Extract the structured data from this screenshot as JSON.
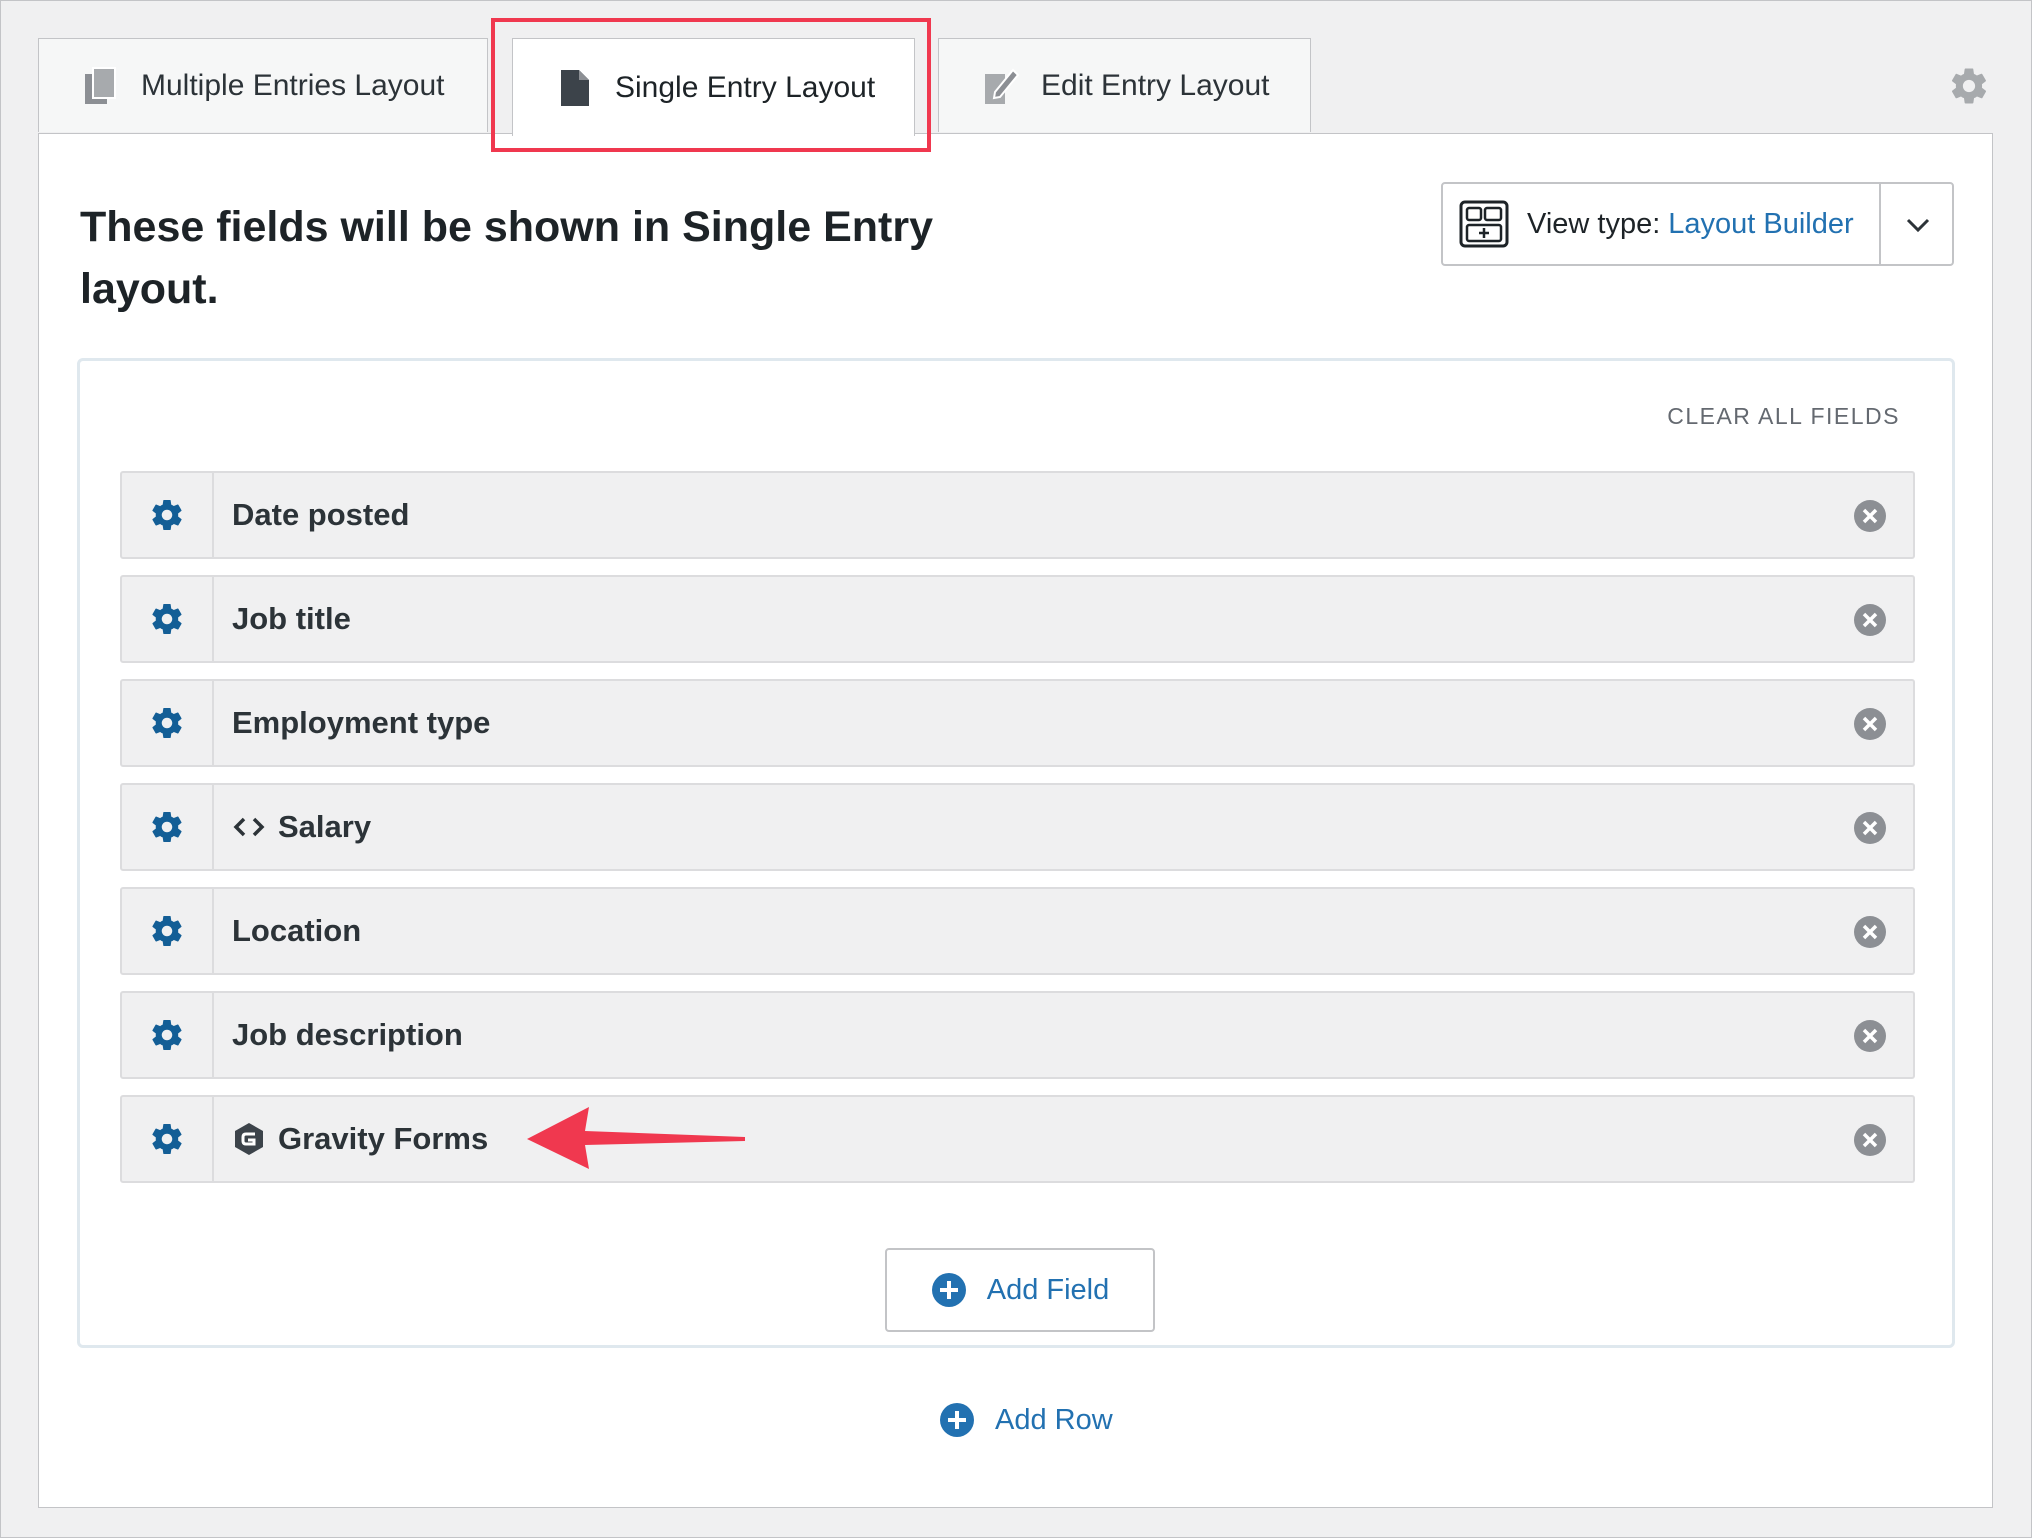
{
  "tabs": [
    {
      "label": "Multiple Entries Layout",
      "icon": "copy-icon"
    },
    {
      "label": "Single Entry Layout",
      "icon": "document-icon",
      "active": true
    },
    {
      "label": "Edit Entry Layout",
      "icon": "edit-icon"
    }
  ],
  "header": {
    "heading": "These fields will be shown in Single Entry layout."
  },
  "view_type": {
    "label": "View type:",
    "value": "Layout Builder"
  },
  "clear_all_label": "CLEAR ALL FIELDS",
  "fields": [
    {
      "label": "Date posted"
    },
    {
      "label": "Job title"
    },
    {
      "label": "Employment type"
    },
    {
      "label": "Salary",
      "prefix_icon": "code-icon"
    },
    {
      "label": "Location"
    },
    {
      "label": "Job description"
    },
    {
      "label": "Gravity Forms",
      "prefix_icon": "gravity-forms-icon"
    }
  ],
  "add_field_label": "Add Field",
  "add_row_label": "Add Row",
  "colors": {
    "accent": "#2271b1",
    "gear": "#135e96",
    "highlight": "#f0384f"
  }
}
